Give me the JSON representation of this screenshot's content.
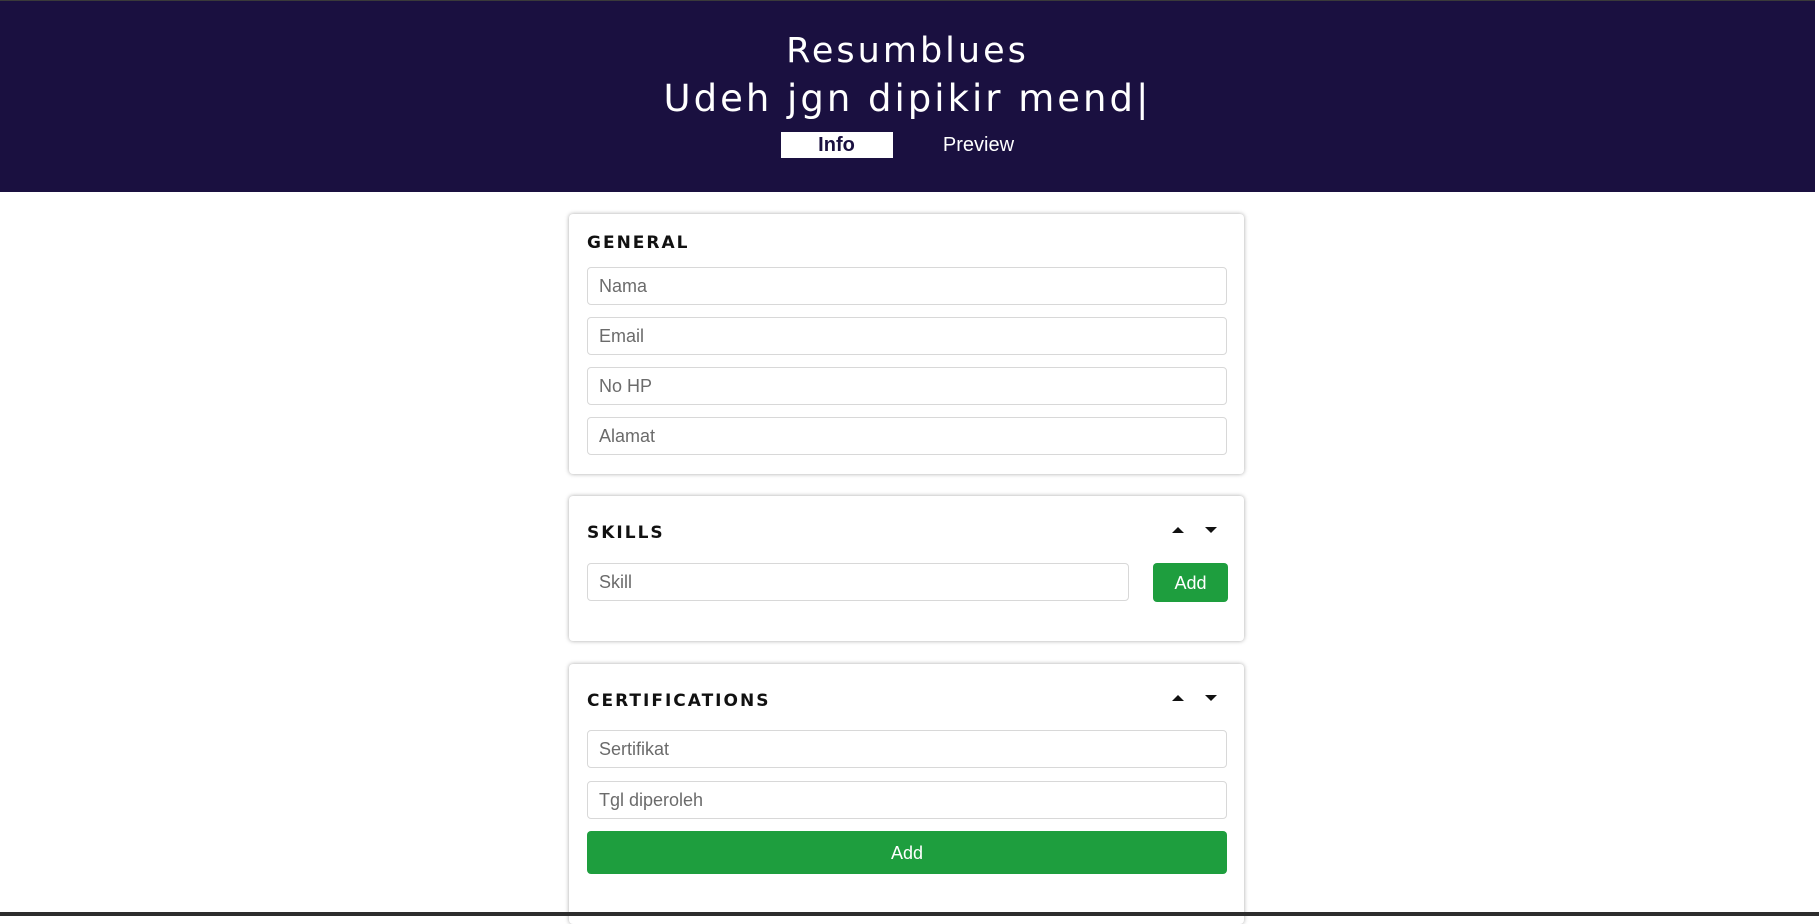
{
  "header": {
    "brand": "Resumblues",
    "tagline": "Udeh jgn dipikir mend|",
    "tabs": [
      {
        "label": "Info",
        "active": true
      },
      {
        "label": "Preview",
        "active": false
      }
    ],
    "background_color": "#1a1040"
  },
  "general": {
    "title": "GENERAL",
    "fields": {
      "nama_placeholder": "Nama",
      "email_placeholder": "Email",
      "nohp_placeholder": "No HP",
      "alamat_placeholder": "Alamat"
    }
  },
  "skills": {
    "title": "SKILLS",
    "skill_placeholder": "Skill",
    "add_label": "Add"
  },
  "certifications": {
    "title": "CERTIFICATIONS",
    "sertifikat_placeholder": "Sertifikat",
    "tgl_placeholder": "Tgl diperoleh",
    "add_label": "Add"
  },
  "icons": {
    "move_up": "caret-up-icon",
    "move_down": "caret-down-icon"
  },
  "colors": {
    "accent_green": "#1e9e3e",
    "header_bg": "#1a1040"
  }
}
